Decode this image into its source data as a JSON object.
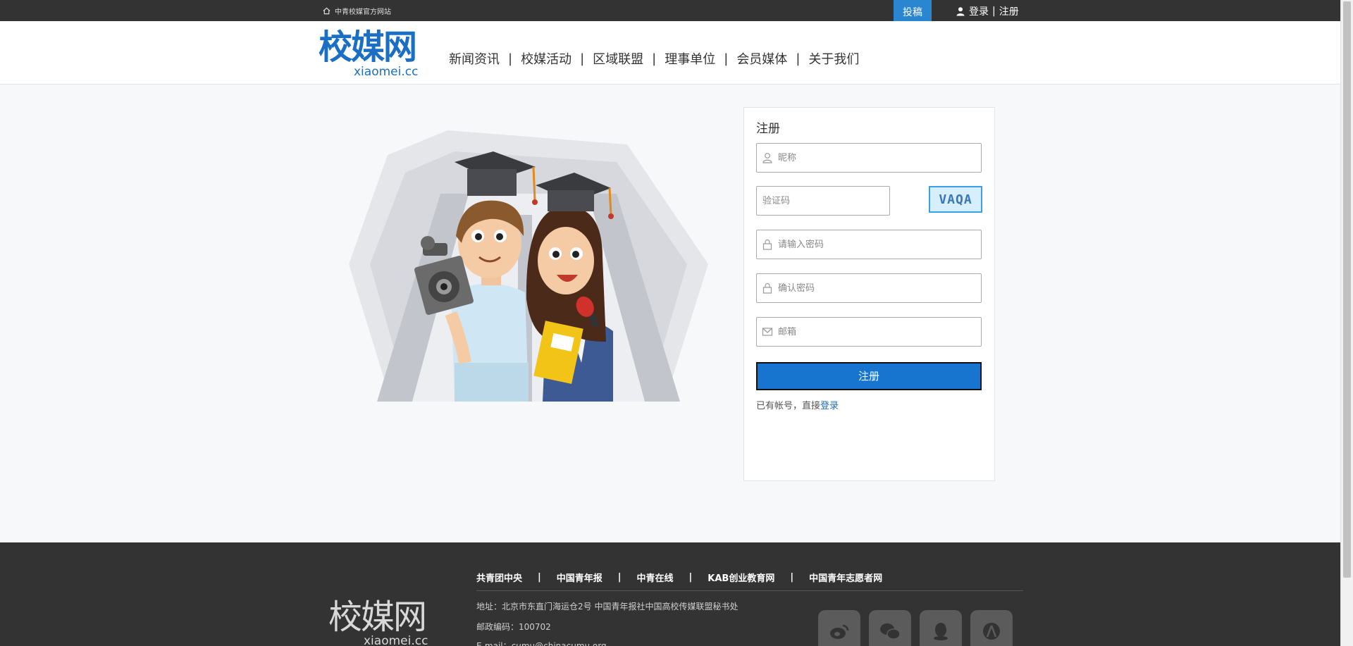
{
  "topbar": {
    "official_site": "中青校媒官方网站",
    "submit": "投稿",
    "login": "登录",
    "divider": "|",
    "register": "注册"
  },
  "header": {
    "logo_cn": "校媒网",
    "logo_en": "xiaomei.cc",
    "nav": [
      "新闻资讯",
      "校媒活动",
      "区域联盟",
      "理事单位",
      "会员媒体",
      "关于我们"
    ],
    "nav_sep": "|"
  },
  "register_form": {
    "title": "注册",
    "nickname_placeholder": "昵称",
    "captcha_placeholder": "验证码",
    "captcha_text": "VAQA",
    "password_placeholder": "请输入密码",
    "confirm_placeholder": "确认密码",
    "email_placeholder": "邮箱",
    "submit_label": "注册",
    "have_account": "已有帐号，直接",
    "login_link": "登录"
  },
  "footer": {
    "logo_cn": "校媒网",
    "logo_en": "xiaomei.cc",
    "links": [
      "共青团中央",
      "中国青年报",
      "中青在线",
      "KAB创业教育网",
      "中国青年志愿者网"
    ],
    "link_sep": "|",
    "address": "地址：北京市东直门海运仓2号 中国青年报社中国高校传媒联盟秘书处",
    "postcode": "邮政编码：100702",
    "email": "E-mail：cumu@chinacumu.org",
    "social": [
      "weibo-icon",
      "wechat-icon",
      "qq-icon",
      "tencent-weibo-icon"
    ]
  },
  "colors": {
    "brand": "#1a6fc4",
    "topbar_bg": "#333333",
    "submit_tab": "#2a86d0",
    "button": "#1875cf"
  }
}
